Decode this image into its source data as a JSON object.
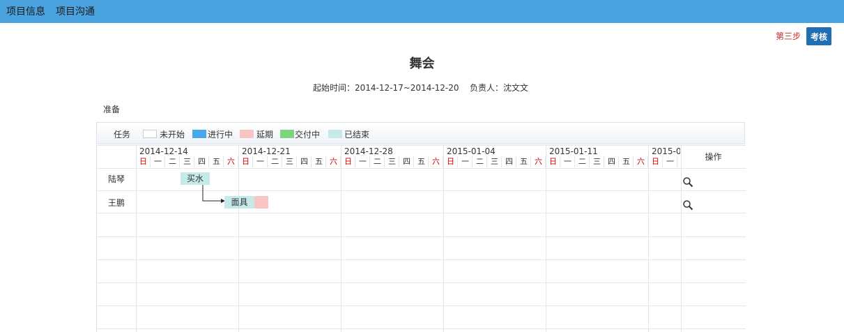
{
  "nav": {
    "items": [
      "项目信息",
      "项目沟通"
    ]
  },
  "step": {
    "label": "第三步",
    "button": "考核"
  },
  "project": {
    "title": "舞会",
    "date_label": "起始时间：2014-12-17~2014-12-20",
    "owner_label": "负责人：沈文文",
    "phase": "准备"
  },
  "legend": {
    "task_label": "任务",
    "items": [
      {
        "label": "未开始",
        "color": "#ffffff"
      },
      {
        "label": "进行中",
        "color": "#4aa8e8"
      },
      {
        "label": "延期",
        "color": "#f9c4c4"
      },
      {
        "label": "交付中",
        "color": "#7ed37e"
      },
      {
        "label": "已结束",
        "color": "#c6eaea"
      }
    ]
  },
  "gantt": {
    "weeks": [
      "2014-12-14",
      "2014-12-21",
      "2014-12-28",
      "2015-01-04",
      "2015-01-11",
      "2015-0"
    ],
    "day_names": [
      "日",
      "一",
      "二",
      "三",
      "四",
      "五",
      "六"
    ],
    "op_header": "操作",
    "rows": [
      {
        "person": "陆琴",
        "task": "买水"
      },
      {
        "person": "王鹏",
        "task": "面具"
      }
    ]
  }
}
